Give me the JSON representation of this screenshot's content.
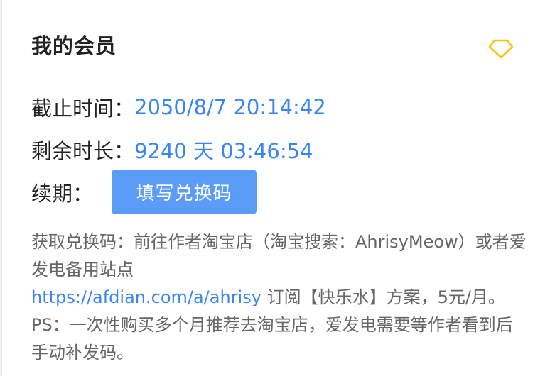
{
  "title": "我的会员",
  "colors": {
    "accent": "#3a86f0",
    "button": "#5a9cf8",
    "diamond": "#f5c518"
  },
  "icon": "diamond-icon",
  "expiry": {
    "label": "截止时间：",
    "value": "2050/8/7 20:14:42"
  },
  "remaining": {
    "label": "剩余时长：",
    "value": "9240 天 03:46:54"
  },
  "renew": {
    "label": "续期：",
    "button_label": "填写兑换码"
  },
  "info": {
    "text_before_link": "获取兑换码：前往作者淘宝店（淘宝搜索：AhrisyMeow）或者爱发电备用站点",
    "link": "https://afdian.com/a/ahrisy",
    "text_after_link": " 订阅【快乐水】方案，5元/月。 PS：一次性购买多个月推荐去淘宝店，爱发电需要等作者看到后手动补发码。"
  }
}
